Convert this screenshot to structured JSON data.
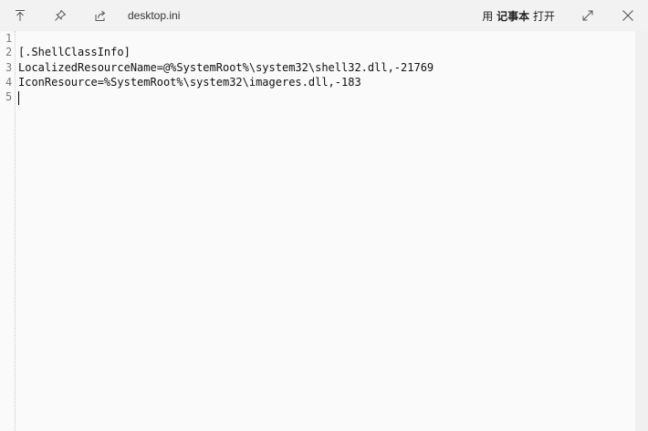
{
  "titlebar": {
    "filename": "desktop.ini",
    "open_with_prefix": "用",
    "open_with_app": "记事本",
    "open_with_suffix": "打开",
    "icons": [
      "move-up-icon",
      "pin-icon",
      "share-icon",
      "expand-icon",
      "close-icon"
    ]
  },
  "editor": {
    "line_numbers": [
      "1",
      "2",
      "3",
      "4",
      "5"
    ],
    "lines": [
      "",
      "[.ShellClassInfo]",
      "LocalizedResourceName=@%SystemRoot%\\system32\\shell32.dll,-21769",
      "IconResource=%SystemRoot%\\system32\\imageres.dll,-183",
      ""
    ]
  }
}
